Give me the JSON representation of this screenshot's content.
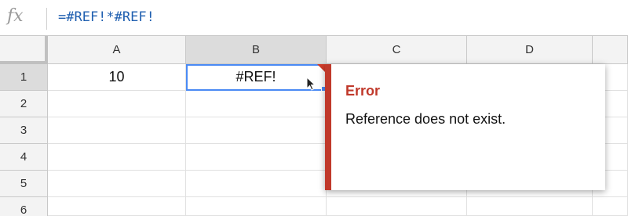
{
  "formula_bar": {
    "fx_label": "fx",
    "formula": "=#REF!*#REF!"
  },
  "columns": [
    "A",
    "B",
    "C",
    "D"
  ],
  "rows": [
    "1",
    "2",
    "3",
    "4",
    "5",
    "6"
  ],
  "cells": {
    "A1": "10",
    "B1": "#REF!"
  },
  "selected_cell": "B1",
  "error_popup": {
    "title": "Error",
    "message": "Reference does not exist."
  },
  "colors": {
    "error_red": "#c0392b",
    "selection_blue": "#4a8af4",
    "formula_blue": "#1f5fb0"
  }
}
